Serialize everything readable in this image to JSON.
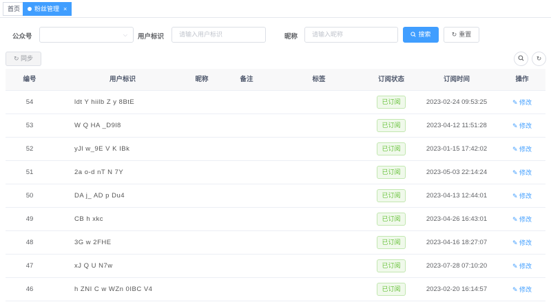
{
  "tabs": {
    "home": "首页",
    "active": "粉丝管理",
    "close": "×"
  },
  "form": {
    "account_label": "公众号",
    "account_value": "",
    "openid_label": "用户标识",
    "openid_placeholder": "请输入用户标识",
    "nickname_label": "昵称",
    "nickname_placeholder": "请输入昵称",
    "search_label": "搜索",
    "reset_label": "重置"
  },
  "toolbar": {
    "sync_label": "同步"
  },
  "table": {
    "headers": [
      "编号",
      "用户标识",
      "昵称",
      "备注",
      "标签",
      "订阅状态",
      "订阅时间",
      "操作"
    ],
    "status_text": "已订阅",
    "edit_text": "修改",
    "rows": [
      {
        "id": "54",
        "openid": "ldt  Y  hiilb  Z  y  8BtE",
        "time": "2023-02-24 09:53:25"
      },
      {
        "id": "53",
        "openid": "W   Q  HA   _D9l8",
        "time": "2023-04-12 11:51:28"
      },
      {
        "id": "52",
        "openid": "yJl   w_9E  V  K IBk",
        "time": "2023-01-15 17:42:02"
      },
      {
        "id": "51",
        "openid": "2a   o-d nT   N  7Y",
        "time": "2023-05-03 22:14:24"
      },
      {
        "id": "50",
        "openid": "DA  j_ AD  p  Du4",
        "time": "2023-04-13 12:44:01"
      },
      {
        "id": "49",
        "openid": "  CB    h   xkc",
        "time": "2023-04-26 16:43:01"
      },
      {
        "id": "48",
        "openid": "3G   w  2FHE",
        "time": "2023-04-16 18:27:07"
      },
      {
        "id": "47",
        "openid": "xJ  Q  U  N7w",
        "time": "2023-07-28 07:10:20"
      },
      {
        "id": "46",
        "openid": "h  ZNI  C  w  WZn  0IBC  V4",
        "time": "2023-02-20 16:14:57"
      }
    ]
  },
  "icons": {
    "search": "search-icon",
    "refresh": "refresh-icon",
    "edit": "edit-icon",
    "sync": "sync-icon"
  },
  "colors": {
    "primary": "#409eff",
    "success": "#67c23a",
    "header_bg": "#f8f8f9"
  }
}
